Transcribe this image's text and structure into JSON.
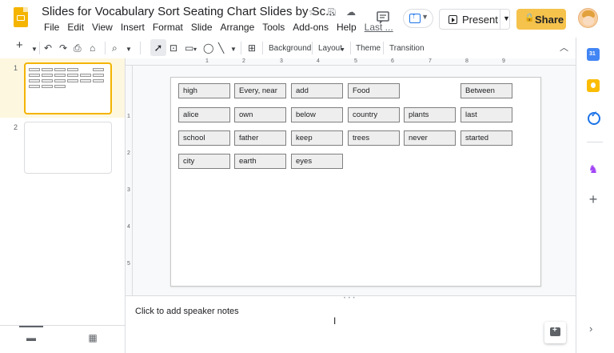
{
  "app": {
    "doc_title": "Slides for Vocabulary Sort Seating Chart Slides by Sc...",
    "menu": [
      "File",
      "Edit",
      "View",
      "Insert",
      "Format",
      "Slide",
      "Arrange",
      "Tools",
      "Add-ons",
      "Help"
    ],
    "last_edit": "Last ...",
    "present_label": "Present",
    "share_label": "Share",
    "icons": {
      "star": "star-icon",
      "move": "move-to-folder-icon",
      "cloud": "cloud-status-icon",
      "comments": "comment-history-icon"
    }
  },
  "toolbar": {
    "background_label": "Background",
    "layout_label": "Layout",
    "theme_label": "Theme",
    "transition_label": "Transition"
  },
  "filmstrip": {
    "slides": [
      {
        "number": "1"
      },
      {
        "number": "2"
      }
    ]
  },
  "ruler": {
    "h_numbers": [
      "1",
      "2",
      "3",
      "4",
      "5",
      "6",
      "7",
      "8",
      "9"
    ],
    "v_numbers": [
      "1",
      "2",
      "3",
      "4",
      "5"
    ]
  },
  "slide": {
    "words": [
      [
        "high",
        "Every, near",
        "add",
        "Food",
        "",
        "Between"
      ],
      [
        "alice",
        "own",
        "below",
        "country",
        "plants",
        "last"
      ],
      [
        "school",
        "father",
        "keep",
        "trees",
        "never",
        "started"
      ],
      [
        "city",
        "earth",
        "eyes"
      ]
    ]
  },
  "notes": {
    "placeholder": "Click to add speaker notes"
  },
  "colors": {
    "slides_brand": "#f4b400",
    "share_button": "#f5c24c",
    "selected_slide_bg": "#fef7e0",
    "cell_fill": "#eeeeee",
    "cell_border": "#7f7f7f"
  }
}
